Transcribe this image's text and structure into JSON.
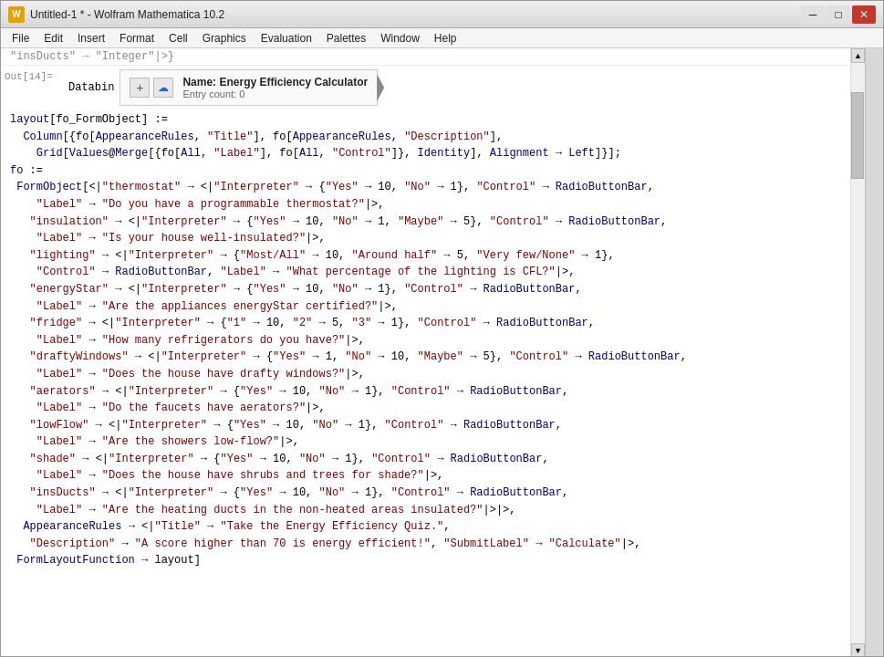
{
  "titlebar": {
    "title": "Untitled-1 * - Wolfram Mathematica 10.2",
    "icon_label": "W"
  },
  "menu": {
    "items": [
      "File",
      "Edit",
      "Insert",
      "Format",
      "Cell",
      "Graphics",
      "Evaluation",
      "Palettes",
      "Window",
      "Help"
    ]
  },
  "output": {
    "label": "Out[14]=",
    "widget": {
      "name_label": "Name:",
      "name_value": "Energy Efficiency Calculator",
      "entry_label": "Entry count:",
      "entry_value": "0"
    }
  },
  "top_snippet": "\"insDucts\" → \"Integer\"|>}",
  "code_lines": [
    "",
    "layout[fo_FormObject] :=",
    "  Column[{fo[AppearanceRules, \"Title\"], fo[AppearanceRules, \"Description\"],",
    "    Grid[Values@Merge[{fo[All, \"Label\"], fo[All, \"Control\"]}, Identity], Alignment → Left]}];",
    "fo :=",
    " FormObject[<|\"thermostat\" → <|\"Interpreter\" → {\"Yes\" → 10, \"No\" → 1}, \"Control\" → RadioButtonBar,",
    "    \"Label\" → \"Do you have a programmable thermostat?\"|>,",
    "   \"insulation\" → <|\"Interpreter\" → {\"Yes\" → 10, \"No\" → 1, \"Maybe\" → 5}, \"Control\" → RadioButtonBar,",
    "    \"Label\" → \"Is your house well-insulated?\"|>,",
    "   \"lighting\" → <|\"Interpreter\" → {\"Most/All\" → 10, \"Around half\" → 5, \"Very few/None\" → 1},",
    "    \"Control\" → RadioButtonBar, \"Label\" → \"What percentage of the lighting is CFL?\"|>,",
    "   \"energyStar\" → <|\"Interpreter\" → {\"Yes\" → 10, \"No\" → 1}, \"Control\" → RadioButtonBar,",
    "    \"Label\" → \"Are the appliances energyStar certified?\"|>,",
    "   \"fridge\" → <|\"Interpreter\" → {\"1\" → 10, \"2\" → 5, \"3\" → 1}, \"Control\" → RadioButtonBar,",
    "    \"Label\" → \"How many refrigerators do you have?\"|>,",
    "   \"draftyWindows\" → <|\"Interpreter\" → {\"Yes\" → 1, \"No\" → 10, \"Maybe\" → 5}, \"Control\" → RadioButtonBar,",
    "    \"Label\" → \"Does the house have drafty windows?\"|>,",
    "   \"aerators\" → <|\"Interpreter\" → {\"Yes\" → 10, \"No\" → 1}, \"Control\" → RadioButtonBar,",
    "    \"Label\" → \"Do the faucets have aerators?\"|>,",
    "   \"lowFlow\" → <|\"Interpreter\" → {\"Yes\" → 10, \"No\" → 1}, \"Control\" → RadioButtonBar,",
    "    \"Label\" → \"Are the showers low-flow?\"|>,",
    "   \"shade\" → <|\"Interpreter\" → {\"Yes\" → 10, \"No\" → 1}, \"Control\" → RadioButtonBar,",
    "    \"Label\" → \"Does the house have shrubs and trees for shade?\"|>,",
    "   \"insDucts\" → <|\"Interpreter\" → {\"Yes\" → 10, \"No\" → 1}, \"Control\" → RadioButtonBar,",
    "    \"Label\" → \"Are the heating ducts in the non-heated areas insulated?\"|>|>,",
    "  AppearanceRules → <|\"Title\" → \"Take the Energy Efficiency Quiz.\",",
    "   \"Description\" → \"A score higher than 70 is energy efficient!\", \"SubmitLabel\" → \"Calculate\"|>,",
    " FormLayoutFunction → layout]"
  ],
  "win_controls": {
    "minimize": "─",
    "maximize": "□",
    "close": "✕"
  }
}
